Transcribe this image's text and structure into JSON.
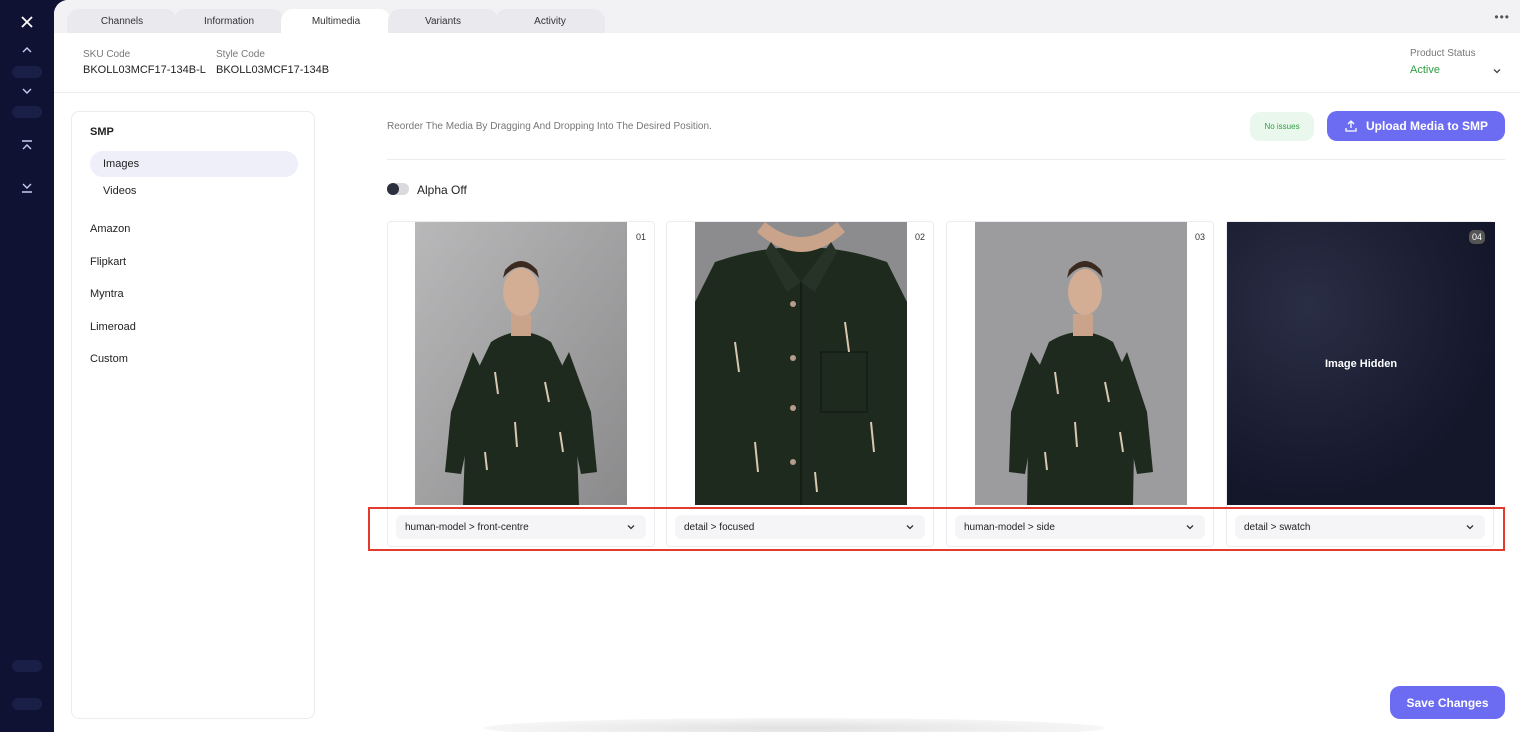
{
  "tabs": [
    {
      "label": "Channels"
    },
    {
      "label": "Information"
    },
    {
      "label": "Multimedia"
    },
    {
      "label": "Variants"
    },
    {
      "label": "Activity"
    }
  ],
  "active_tab": "Multimedia",
  "header": {
    "sku_label": "SKU Code",
    "sku_value": "BKOLL03MCF17-134B-L",
    "style_label": "Style Code",
    "style_value": "BKOLL03MCF17-134B",
    "status_label": "Product Status",
    "status_value": "Active"
  },
  "sidebar": {
    "title": "SMP",
    "sub_items": [
      {
        "label": "Images"
      },
      {
        "label": "Videos"
      }
    ],
    "items": [
      {
        "label": "Amazon"
      },
      {
        "label": "Flipkart"
      },
      {
        "label": "Myntra"
      },
      {
        "label": "Limeroad"
      },
      {
        "label": "Custom"
      }
    ]
  },
  "content": {
    "hint": "Reorder The Media By Dragging And Dropping Into The Desired Position.",
    "badge": "No issues",
    "upload_label": "Upload Media to SMP",
    "alpha_label": "Alpha Off",
    "save_label": "Save Changes"
  },
  "media": [
    {
      "index": "01",
      "tag": "human-model > front-centre"
    },
    {
      "index": "02",
      "tag": "detail > focused"
    },
    {
      "index": "03",
      "tag": "human-model > side"
    },
    {
      "index": "04",
      "tag": "detail > swatch",
      "hidden_label": "Image Hidden"
    }
  ],
  "colors": {
    "accent": "#6c6cf2",
    "status_active": "#2ea043",
    "highlight": "#e23a2e",
    "rail": "#0f1233"
  }
}
